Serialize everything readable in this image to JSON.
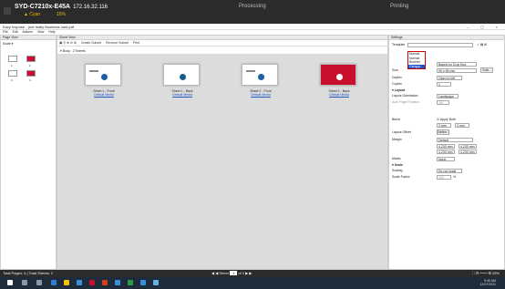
{
  "header": {
    "printer": "SYD-C7210x-E45A",
    "ip": "172.16.32.116",
    "status": "Cyan",
    "percent": "16%",
    "processing": "Processing",
    "printing": "Printing"
  },
  "window": {
    "title": "Eazy Inspose - (not really Business card.pdf",
    "controls": "– ◻ ×"
  },
  "menu": [
    "File",
    "Edit",
    "Actions",
    "View",
    "Help"
  ],
  "page_view": {
    "title": "Page View",
    "scale": "Scale ▾",
    "pages": [
      "1",
      "2",
      "3",
      "4"
    ]
  },
  "sheet_view": {
    "title": "Sheet View",
    "tools": [
      "Create Subset",
      "Remove Subset",
      "Print"
    ],
    "body_label": "Body : 2 Sheets",
    "sheets": [
      {
        "name": "Sheet 1 - Front",
        "media": "Default Media"
      },
      {
        "name": "Sheet 1 - Back",
        "media": "Default Media"
      },
      {
        "name": "Sheet 2 - Front",
        "media": "Default Media"
      },
      {
        "name": "Sheet 2 - Back",
        "media": "Default Media"
      }
    ]
  },
  "settings": {
    "title": "Settings",
    "template_label": "Template",
    "template_options": [
      "Normal",
      "Normal",
      "Booklet",
      "Gangup"
    ],
    "layout_value": "Based on Crop Box",
    "size_label": "Size",
    "size_value": "90 x 55 mm",
    "edit_button": "Edit...",
    "duplex_label": "Duplex",
    "duplex_value": "Open to left",
    "copies_label": "Copies",
    "copies_value": "1",
    "layout_section": "Layout",
    "orientation_label": "Layout Orientation",
    "orientation_value": "Landscape",
    "auto_label": "Auto Page Rotation",
    "auto_value": "Off",
    "bleed_label": "Bleed",
    "apply_both": "Apply Both",
    "bleed_a": "3 mm",
    "bleed_b": "3 mm",
    "offset_label": "Layout Offset",
    "define_button": "Define...",
    "margin_label": "Margin",
    "margin_value": "Default",
    "margin_vals": [
      "4.233 mm",
      "4.233 mm",
      "4.233 mm",
      "4.233 mm"
    ],
    "marks_label": "Marks",
    "marks_value": "None",
    "scale_section": "Scale",
    "scaling_label": "Scaling",
    "scaling_value": "Do not scale",
    "factor_label": "Scale Factor",
    "factor_value": "100",
    "factor_unit": "%"
  },
  "status": {
    "total": "Total Pages: 4 | Total Sheets: 2",
    "sheet_label": "Sheet",
    "sheet_num": "1",
    "of": "of 2",
    "zoom": "25%"
  },
  "taskbar": {
    "time": "9:46 AM",
    "date": "12/07/2021"
  },
  "colors": {
    "accent": "#c8102e",
    "link": "#1a56c8",
    "warning": "#f7b500"
  }
}
